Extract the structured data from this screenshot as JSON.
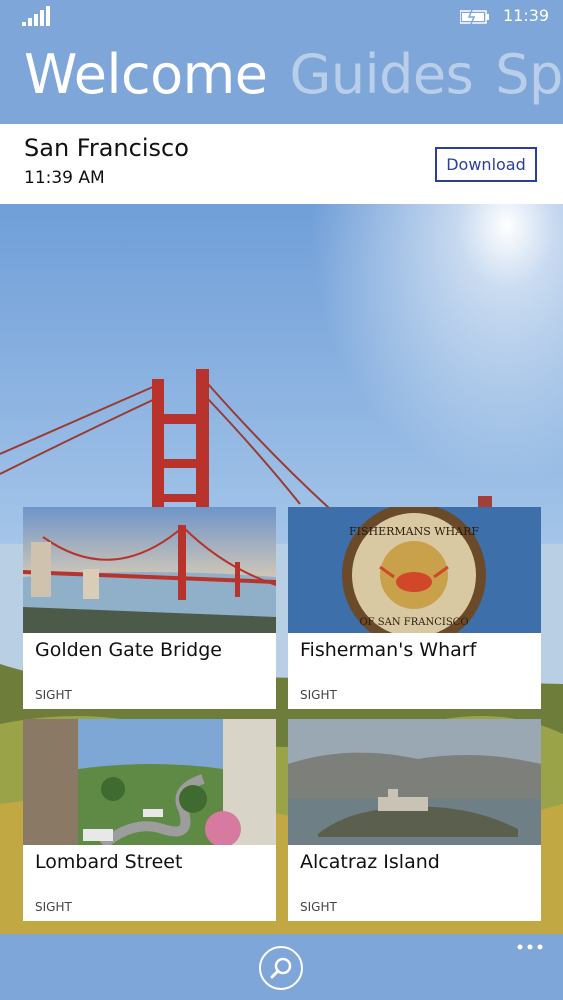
{
  "status": {
    "time": "11:39"
  },
  "pivot": {
    "items": [
      "Welcome",
      "Guides",
      "Spe"
    ]
  },
  "city": {
    "name": "San Francisco",
    "time": "11:39 AM",
    "download_label": "Download"
  },
  "cards": [
    {
      "name": "Golden Gate Bridge",
      "kind": "SIGHT"
    },
    {
      "name": "Fisherman's Wharf",
      "kind": "SIGHT"
    },
    {
      "name": "Lombard Street",
      "kind": "SIGHT"
    },
    {
      "name": "Alcatraz Island",
      "kind": "SIGHT"
    }
  ],
  "sign_text": {
    "top": "FISHERMANS WHARF",
    "bottom": "OF SAN FRANCISCO"
  },
  "colors": {
    "accent": "#7fa6d8",
    "button_border": "#2c3e9c",
    "bridge": "#b8332c"
  },
  "appbar": {
    "icons": [
      "search-icon",
      "more-icon"
    ]
  }
}
